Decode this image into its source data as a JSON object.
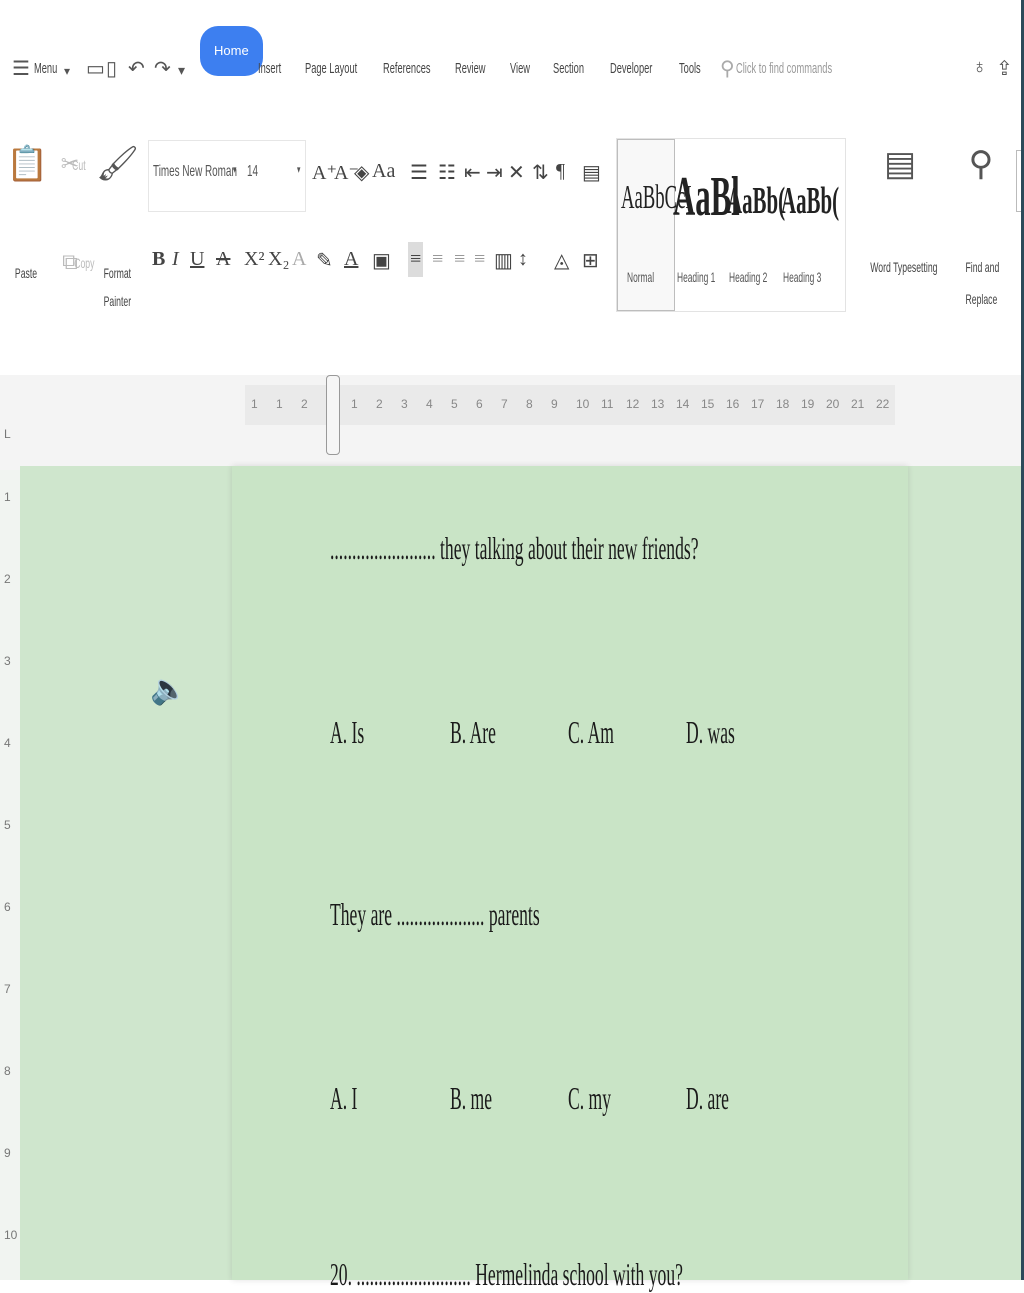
{
  "menu": {
    "menu_label": "Menu",
    "tabs": [
      "Home",
      "Insert",
      "Page Layout",
      "References",
      "Review",
      "View",
      "Section",
      "Developer",
      "Tools"
    ],
    "active_tab": "Home",
    "search_placeholder": "Click to find commands"
  },
  "ribbon": {
    "paste": "Paste",
    "cut": "Cut",
    "copy": "Copy",
    "format_painter_1": "Format",
    "format_painter_2": "Painter",
    "font_name": "Times New Roman",
    "font_size": "14",
    "styles": [
      {
        "preview": "AaBbCcI",
        "name": "Normal"
      },
      {
        "preview": "AaBl",
        "name": "Heading 1"
      },
      {
        "preview": "AaBb(",
        "name": "Heading 2"
      },
      {
        "preview": "AaBb(",
        "name": "Heading 3"
      }
    ],
    "word_typesetting": "Word Typesetting",
    "find_replace_1": "Find and",
    "find_replace_2": "Replace"
  },
  "document": {
    "q1_text": "........................ they talking about their new friends?",
    "q1_options": [
      "A. Is",
      "B. Are",
      "C. Am",
      "D. was"
    ],
    "q2_text": "They are .................... parents",
    "q2_options": [
      "A. I",
      "B. me",
      "C. my",
      "D. are"
    ],
    "q3_text": "20. .......................... Hermelinda school with you?"
  },
  "ruler_ticks": [
    "1",
    "1",
    "2",
    "1",
    "1",
    "2",
    "3",
    "4",
    "5",
    "6",
    "7",
    "8",
    "9",
    "10",
    "11",
    "12",
    "13",
    "14",
    "15",
    "16",
    "17",
    "18",
    "19",
    "20",
    "21",
    "22"
  ],
  "vruler_ticks": [
    "1",
    "2",
    "3",
    "4",
    "5",
    "6",
    "7",
    "8",
    "9",
    "10"
  ]
}
